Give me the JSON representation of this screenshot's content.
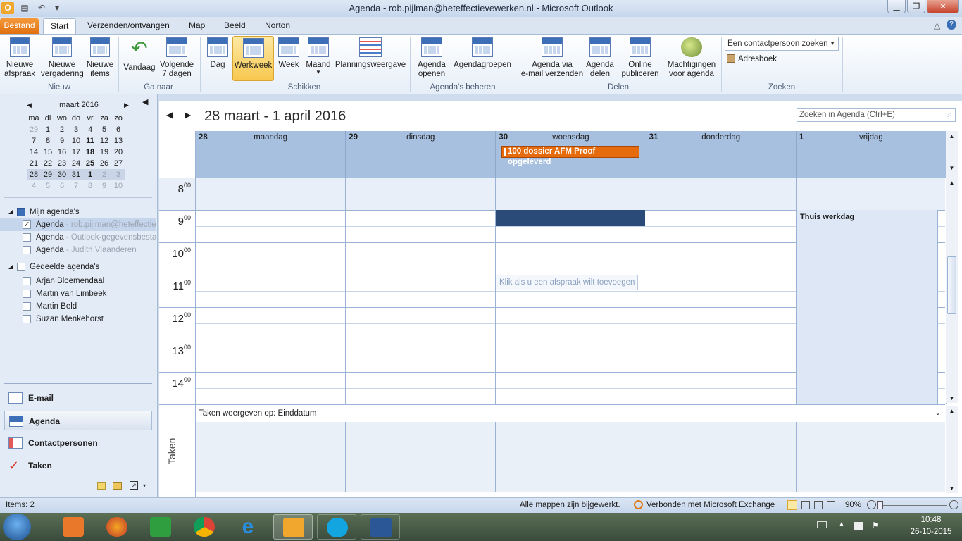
{
  "window": {
    "title": "Agenda - rob.pijlman@heteffectievewerken.nl  -  Microsoft Outlook"
  },
  "tabs": [
    "Bestand",
    "Start",
    "Verzenden/ontvangen",
    "Map",
    "Beeld",
    "Norton"
  ],
  "ribbon": {
    "nieuw": {
      "label": "Nieuw",
      "afspraak": "Nieuwe\nafspraak",
      "vergadering": "Nieuwe\nvergadering",
      "items": "Nieuwe\nitems"
    },
    "ganaar": {
      "label": "Ga naar",
      "vandaag": "Vandaag",
      "volgende": "Volgende\n7 dagen"
    },
    "schikken": {
      "label": "Schikken",
      "dag": "Dag",
      "werkweek": "Werkweek",
      "week": "Week",
      "maand": "Maand",
      "planning": "Planningsweergave"
    },
    "beheren": {
      "label": "Agenda's beheren",
      "openen": "Agenda\nopenen",
      "groepen": "Agendagroepen"
    },
    "delen": {
      "label": "Delen",
      "email": "Agenda via\ne-mail verzenden",
      "delen": "Agenda\ndelen",
      "online": "Online\npubliceren",
      "machtigingen": "Machtigingen\nvoor agenda"
    },
    "zoeken": {
      "label": "Zoeken",
      "contact_placeholder": "Een contactpersoon zoeken",
      "adresboek": "Adresboek"
    }
  },
  "minical": {
    "month": "maart 2016",
    "weekdays": [
      "ma",
      "di",
      "wo",
      "do",
      "vr",
      "za",
      "zo"
    ],
    "weeks": [
      [
        "29",
        "1",
        "2",
        "3",
        "4",
        "5",
        "6"
      ],
      [
        "7",
        "8",
        "9",
        "10",
        "11",
        "12",
        "13"
      ],
      [
        "14",
        "15",
        "16",
        "17",
        "18",
        "19",
        "20"
      ],
      [
        "21",
        "22",
        "23",
        "24",
        "25",
        "26",
        "27"
      ],
      [
        "28",
        "29",
        "30",
        "31",
        "1",
        "2",
        "3"
      ],
      [
        "4",
        "5",
        "6",
        "7",
        "8",
        "9",
        "10"
      ]
    ]
  },
  "tree": {
    "mijn": "Mijn agenda's",
    "mijn_items": [
      {
        "name": "Agenda",
        "sub": " - rob.pijlman@heteffectievewerken.nl",
        "checked": true
      },
      {
        "name": "Agenda",
        "sub": " - Outlook-gegevensbestand",
        "checked": false
      },
      {
        "name": "Agenda",
        "sub": " - Judith Vlaanderen",
        "checked": false
      }
    ],
    "gedeeld": "Gedeelde agenda's",
    "gedeeld_items": [
      "Arjan Bloemendaal",
      "Martin van Limbeek",
      "Martin Beld",
      "Suzan Menkehorst"
    ]
  },
  "nav": [
    "E-mail",
    "Agenda",
    "Contactpersonen",
    "Taken"
  ],
  "calendar": {
    "range": "28 maart - 1 april 2016",
    "search_placeholder": "Zoeken in Agenda (Ctrl+E)",
    "days": [
      {
        "num": "28",
        "name": "maandag"
      },
      {
        "num": "29",
        "name": "dinsdag"
      },
      {
        "num": "30",
        "name": "woensdag"
      },
      {
        "num": "31",
        "name": "donderdag"
      },
      {
        "num": "1",
        "name": "vrijdag"
      }
    ],
    "hours": [
      "8",
      "9",
      "10",
      "11",
      "12",
      "13",
      "14"
    ],
    "minutes": "00",
    "allday_event": "100 dossier AFM Proof opgeleverd",
    "friday_event": "Thuis werkdag",
    "click_hint": "Klik als u een afspraak wilt toevoegen",
    "tasks_label": "Taken weergeven op: Einddatum",
    "tasks_side": "Taken"
  },
  "status": {
    "items": "Items: 2",
    "updated": "Alle mappen zijn bijgewerkt.",
    "exchange": "Verbonden met Microsoft Exchange",
    "zoom": "90%"
  },
  "taskbar": {
    "time": "10:48",
    "date": "26-10-2015"
  },
  "colors": {
    "accent": "#e1700f",
    "header": "#a7c0e0",
    "event_dark": "#2a4a78"
  }
}
